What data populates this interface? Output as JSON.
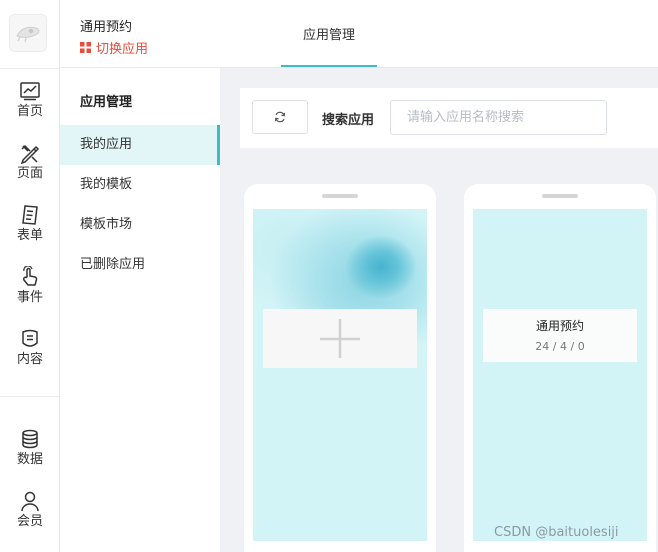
{
  "colors": {
    "accent": "#3bbcc6",
    "switch_app": "#e74c3c",
    "screen_bg": "#d3f4f7"
  },
  "rail": {
    "items": [
      {
        "label": "首页",
        "icon": "chart-icon"
      },
      {
        "label": "页面",
        "icon": "edit-tools-icon"
      },
      {
        "label": "表单",
        "icon": "form-icon"
      },
      {
        "label": "事件",
        "icon": "hand-tap-icon"
      },
      {
        "label": "内容",
        "icon": "content-icon"
      }
    ],
    "bottom_items": [
      {
        "label": "数据",
        "icon": "database-icon"
      },
      {
        "label": "会员",
        "icon": "user-icon"
      }
    ]
  },
  "header": {
    "app_title": "通用预约",
    "switch_app_label": "切换应用",
    "tab_label": "应用管理"
  },
  "subnav": {
    "title": "应用管理",
    "items": [
      {
        "label": "我的应用",
        "active": true
      },
      {
        "label": "我的模板",
        "active": false
      },
      {
        "label": "模板市场",
        "active": false
      },
      {
        "label": "已删除应用",
        "active": false
      }
    ]
  },
  "search": {
    "label": "搜索应用",
    "placeholder": "请输入应用名称搜索",
    "value": ""
  },
  "apps": [
    {
      "name": "通用预约",
      "stats": "24 / 4 / 0"
    }
  ],
  "watermark": "CSDN @baituolesiji"
}
